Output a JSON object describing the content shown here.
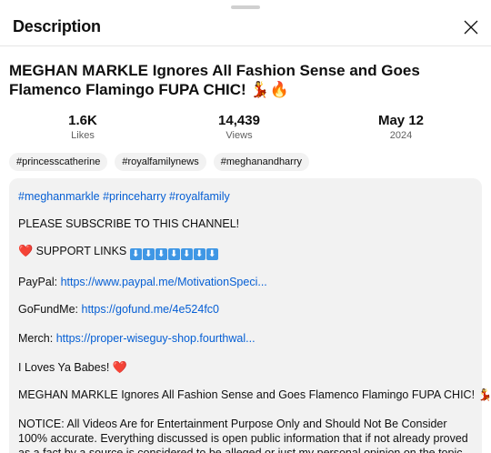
{
  "header": {
    "title": "Description"
  },
  "video": {
    "title": "MEGHAN MARKLE Ignores All Fashion Sense and Goes Flamenco Flamingo FUPA CHIC! 💃🔥"
  },
  "stats": [
    {
      "value": "1.6K",
      "label": "Likes"
    },
    {
      "value": "14,439",
      "label": "Views"
    },
    {
      "value": "May 12",
      "label": "2024"
    }
  ],
  "hashtags": [
    "#princesscatherine",
    "#royalfamilynews",
    "#meghanandharry"
  ],
  "description": {
    "tags_line": "#meghanmarkle #princeharry #royalfamily",
    "subscribe": "PLEASE SUBSCRIBE TO THIS CHANNEL!",
    "support_heart": "❤️",
    "support_label": "SUPPORT LINKS",
    "support_arrows": [
      "⬇",
      "⬇",
      "⬇",
      "⬇",
      "⬇",
      "⬇",
      "⬇"
    ],
    "paypal_label": "PayPal:",
    "paypal_link": "https://www.paypal.me/MotivationSpeci...",
    "gofundme_label": "GoFundMe:",
    "gofundme_link": "https://gofund.me/4e524fc0",
    "merch_label": "Merch:",
    "merch_link": "https://proper-wiseguy-shop.fourthwal...",
    "love_text": "I Loves Ya Babes!",
    "love_heart": "❤️",
    "title_repeat": "MEGHAN MARKLE Ignores All Fashion Sense and Goes Flamenco Flamingo FUPA CHIC! 💃🔥",
    "notice": "NOTICE: All Videos Are for Entertainment Purpose Only and Should Not Be Consider 100% accurate. Everything discussed is open public information that if not already proved as a fact by a source is considered to be alleged or just my personal opinion on the topic. Thank You!"
  },
  "icons": {
    "close": "close-icon",
    "arrow": "down-arrow-icon"
  },
  "colors": {
    "link": "#065fd4",
    "heart": "#e0245e",
    "arrow_box": "#3f97e5",
    "chip_bg": "#f2f2f2"
  }
}
